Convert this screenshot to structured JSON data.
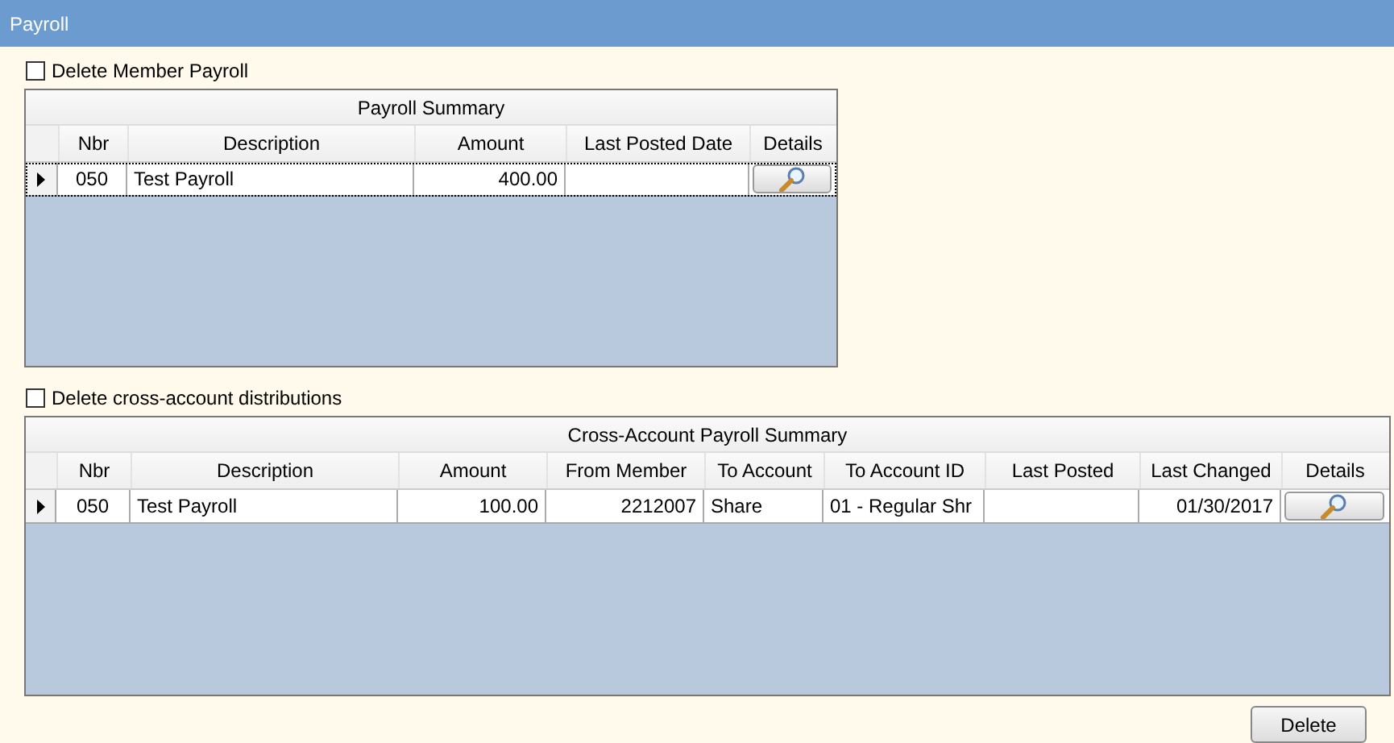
{
  "title": "Payroll",
  "sections": [
    {
      "checkbox": {
        "label": "Delete Member Payroll",
        "checked": false
      },
      "grid": {
        "title": "Payroll Summary",
        "columns": [
          {
            "label": "Nbr",
            "kind": "code"
          },
          {
            "label": "Description",
            "kind": "text"
          },
          {
            "label": "Amount",
            "kind": "number"
          },
          {
            "label": "Last Posted Date",
            "kind": "text"
          },
          {
            "label": "Details",
            "kind": "button"
          }
        ],
        "rows": [
          {
            "current": true,
            "focused": true,
            "cells": [
              "050",
              "Test Payroll",
              "400.00",
              ""
            ]
          }
        ]
      }
    },
    {
      "checkbox": {
        "label": "Delete cross-account distributions",
        "checked": false
      },
      "grid": {
        "title": "Cross-Account Payroll Summary",
        "columns": [
          {
            "label": "Nbr",
            "kind": "code"
          },
          {
            "label": "Description",
            "kind": "text"
          },
          {
            "label": "Amount",
            "kind": "number"
          },
          {
            "label": "From Member",
            "kind": "number"
          },
          {
            "label": "To Account",
            "kind": "text"
          },
          {
            "label": "To Account ID",
            "kind": "text"
          },
          {
            "label": "Last Posted",
            "kind": "text"
          },
          {
            "label": "Last Changed",
            "kind": "number"
          },
          {
            "label": "Details",
            "kind": "button"
          }
        ],
        "rows": [
          {
            "current": true,
            "focused": false,
            "cells": [
              "050",
              "Test Payroll",
              "100.00",
              "2212007",
              "Share",
              "01 - Regular Shr",
              "",
              "01/30/2017"
            ]
          }
        ]
      }
    }
  ],
  "buttons": [
    {
      "label": "Delete"
    }
  ]
}
